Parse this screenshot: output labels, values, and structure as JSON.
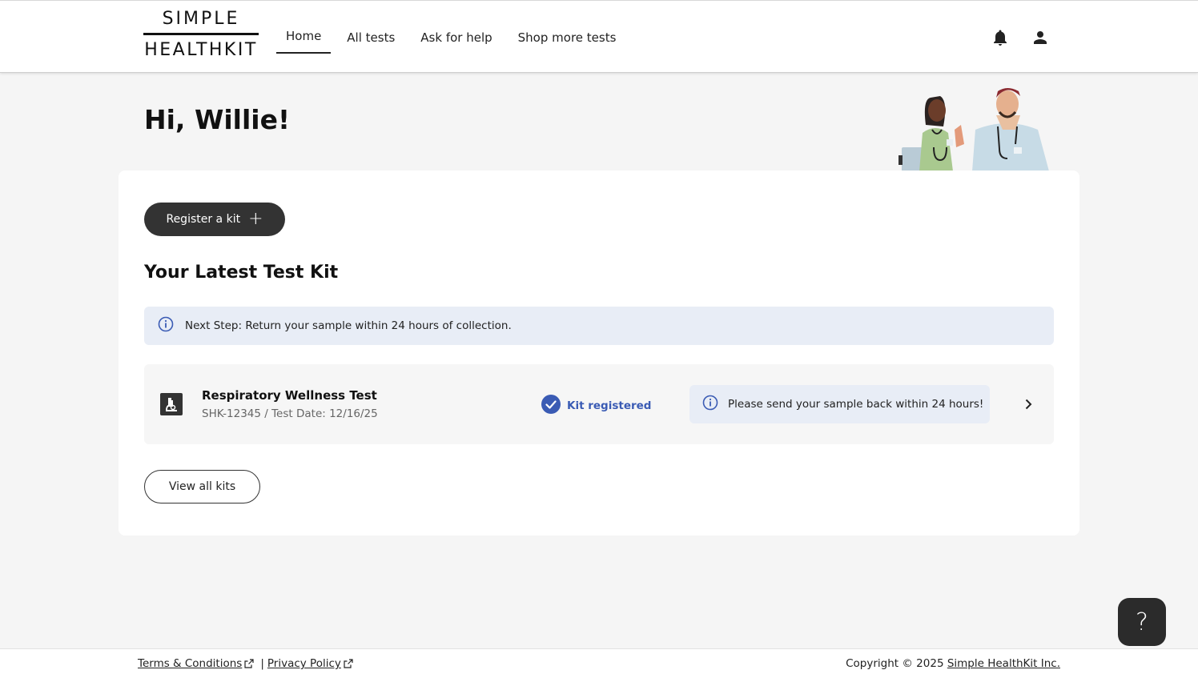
{
  "header": {
    "logo_top": "SIMPLE",
    "logo_bottom": "HEALTHKIT",
    "nav": [
      {
        "label": "Home",
        "active": true
      },
      {
        "label": "All tests",
        "active": false
      },
      {
        "label": "Ask for help",
        "active": false
      },
      {
        "label": "Shop more tests",
        "active": false
      }
    ],
    "icons": [
      "bell-icon",
      "person-icon"
    ]
  },
  "greeting": "Hi, Willie!",
  "card": {
    "register_button": "Register a kit",
    "section_title": "Your Latest Test Kit",
    "next_step": "Next Step: Return your sample within 24 hours of collection.",
    "kit": {
      "name": "Respiratory Wellness Test",
      "meta": "SHK-12345 / Test Date: 12/16/25",
      "status": "Kit registered",
      "note": "Please send your sample back within 24 hours!"
    },
    "view_all_button": "View all kits"
  },
  "help_button": "?",
  "footer": {
    "terms": "Terms & Conditions",
    "separator": "|",
    "privacy": "Privacy Policy",
    "copyright": "Copyright © 2025",
    "company": "Simple HealthKit Inc."
  },
  "colors": {
    "accent": "#3a5bb4",
    "dark_button": "#333333",
    "info_bg": "#e8edf6",
    "page_bg": "#f5f5f5"
  }
}
